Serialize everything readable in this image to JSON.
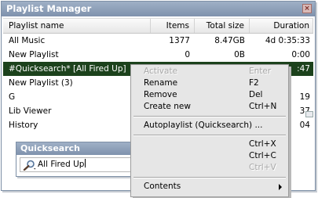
{
  "window": {
    "title": "Playlist Manager",
    "close_glyph": "×"
  },
  "columns": {
    "name": "Playlist name",
    "items": "Items",
    "size": "Total size",
    "duration": "Duration"
  },
  "rows": [
    {
      "name": "All Music",
      "items": "1377",
      "size": "8.47GB",
      "duration": "4d 0:35:33",
      "selected": false
    },
    {
      "name": "New Playlist",
      "items": "0",
      "size": "0B",
      "duration": "0:00",
      "selected": false
    },
    {
      "name": "#Quicksearch* [All Fired Up]",
      "items": "",
      "size": "",
      "duration": ":47",
      "selected": true
    },
    {
      "name": "New Playlist (3)",
      "items": "",
      "size": "",
      "duration": "",
      "selected": false
    },
    {
      "name": "G",
      "items": "",
      "size": "",
      "duration": "19",
      "selected": false
    },
    {
      "name": "Lib Viewer",
      "items": "",
      "size": "",
      "duration": "37",
      "selected": false
    },
    {
      "name": "History",
      "items": "",
      "size": "",
      "duration": "04",
      "selected": false
    }
  ],
  "context_menu": {
    "activate": {
      "label": "Activate",
      "key": "Enter"
    },
    "rename": {
      "label": "Rename",
      "key": "F2"
    },
    "remove": {
      "label": "Remove",
      "key": "Del"
    },
    "create_new": {
      "label": "Create new",
      "key": "Ctrl+N"
    },
    "autoplaylist": {
      "label": "Autoplaylist (Quicksearch) ..."
    },
    "cut": {
      "key": "Ctrl+X"
    },
    "copy": {
      "key": "Ctrl+C"
    },
    "paste": {
      "key": "Ctrl+V"
    },
    "contents": {
      "label": "Contents"
    }
  },
  "quicksearch": {
    "title": "Quicksearch",
    "value": "All Fired Up",
    "close_glyph": "×"
  },
  "colors": {
    "titlebar": "#8a9cb5",
    "selection": "#1c421c",
    "menu_bg": "#e6e6e6",
    "close_bg": "#d9bbb8"
  },
  "icons": [
    "close-icon",
    "search-icon",
    "submenu-arrow-icon"
  ]
}
